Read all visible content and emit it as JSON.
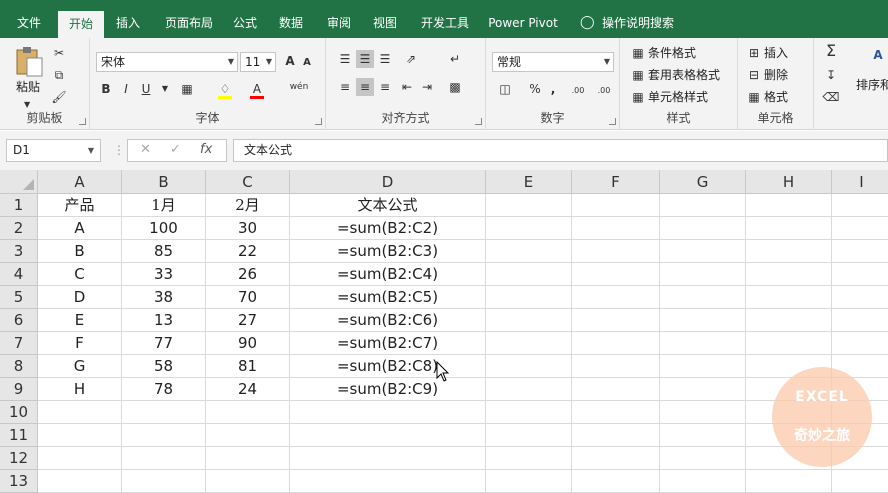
{
  "ribbon_tabs": [
    "文件",
    "开始",
    "插入",
    "页面布局",
    "公式",
    "数据",
    "审阅",
    "视图",
    "开发工具",
    "Power Pivot",
    "操作说明搜索"
  ],
  "ribbon": {
    "clipboard": {
      "paste_label": "粘贴",
      "group_label": "剪贴板"
    },
    "font": {
      "font_name": "宋体",
      "font_size": "11",
      "bold": "B",
      "italic": "I",
      "underline": "U",
      "grow": "A",
      "shrink": "A",
      "phonetic": "wén",
      "group_label": "字体"
    },
    "alignment": {
      "group_label": "对齐方式"
    },
    "number": {
      "format": "常规",
      "percent": "%",
      "comma": ",",
      "inc_decimal": ".00",
      "dec_decimal": ".00",
      "group_label": "数字"
    },
    "styles": {
      "conditional": "条件格式",
      "table_format": "套用表格格式",
      "cell_styles": "单元格样式",
      "group_label": "样式"
    },
    "cells": {
      "insert": "插入",
      "delete": "删除",
      "format": "格式",
      "group_label": "单元格"
    },
    "editing": {
      "sort_filter": "排序和",
      "sum": "Σ"
    }
  },
  "formula_bar": {
    "name_box": "D1",
    "fx": "fx",
    "content": "文本公式"
  },
  "columns": [
    "A",
    "B",
    "C",
    "D",
    "E",
    "F",
    "G",
    "H",
    "I"
  ],
  "rows": [
    "1",
    "2",
    "3",
    "4",
    "5",
    "6",
    "7",
    "8",
    "9",
    "10",
    "11",
    "12",
    "13"
  ],
  "sheet": [
    [
      "产品",
      "1月",
      "2月",
      "文本公式"
    ],
    [
      "A",
      "100",
      "30",
      "=sum(B2:C2)"
    ],
    [
      "B",
      "85",
      "22",
      "=sum(B2:C3)"
    ],
    [
      "C",
      "33",
      "26",
      "=sum(B2:C4)"
    ],
    [
      "D",
      "38",
      "70",
      "=sum(B2:C5)"
    ],
    [
      "E",
      "13",
      "27",
      "=sum(B2:C6)"
    ],
    [
      "F",
      "77",
      "90",
      "=sum(B2:C7)"
    ],
    [
      "G",
      "58",
      "81",
      "=sum(B2:C8)"
    ],
    [
      "H",
      "78",
      "24",
      "=sum(B2:C9)"
    ]
  ],
  "watermark": {
    "line1": "EXCEL",
    "line2": "奇妙之旅"
  },
  "colors": {
    "accent": "#217346",
    "ribbon_bg": "#f3f3f3",
    "header_bg": "#e6e6e6",
    "watermark": "#fbc8aa"
  }
}
